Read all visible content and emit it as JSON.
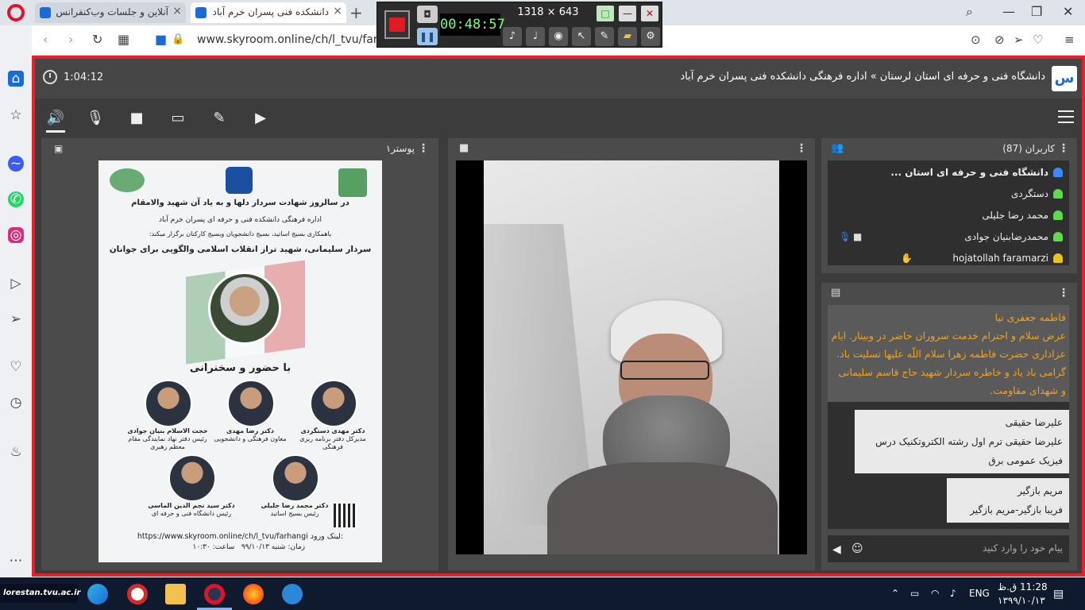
{
  "browser": {
    "tabs": [
      {
        "title": "آنلاین و جلسات وب‌کنفرانس"
      },
      {
        "title": "دانشکده فنی پسران خرم آباد"
      }
    ],
    "new_tab": "+",
    "url": "www.skyroom.online/ch/l_tvu/farhan"
  },
  "recorder": {
    "timer": "00:48:57",
    "dimensions": "1318 × 643",
    "colors": {
      "record": "#e01b24"
    }
  },
  "room": {
    "title": "دانشگاه فنی و حرفه ای استان لرستان » اداره فرهنگی دانشکده فنی پسران خرم آباد",
    "elapsed": "1:04:12",
    "accent_border": "#e8202a"
  },
  "toolbar": {
    "icons": [
      "speaker-icon",
      "mic-muted-icon",
      "camera-icon",
      "screen-share-icon",
      "brush-icon",
      "media-play-icon"
    ]
  },
  "poster_panel": {
    "title": "پوستر۱",
    "poster": {
      "headline1": "در سالروز شهادت سردار دلها و به یاد آن شهید والامقام",
      "headline2": "اداره فرهنگی دانشکده فنی و حرفه ای پسران خرم آباد",
      "headline3": "باهمکاری بسیج اساتید، بسیج دانشجویان وبسیج کارکنان برگزار میکند:",
      "theme": "سردار سلیمانی، شهید تراز انقلاب اسلامی والگویی برای جوانان",
      "with_speech": "با حضور و سخنرانی",
      "speakers": [
        {
          "name": "دکتر مهدی دستگردی",
          "role": "مدیرکل دفتر برنامه ریزی فرهنگی"
        },
        {
          "name": "دکتر رضا مهدی",
          "role": "معاون فرهنگی و دانشجویی"
        },
        {
          "name": "حجت الاسلام بنیان جوادی",
          "role": "رئیس دفتر نهاد نمایندگی مقام معظم رهبری"
        },
        {
          "name": "دکتر محمد رضا جلیلی",
          "role": "رئیس بسیج اساتید"
        },
        {
          "name": "دکتر سید نجم الدین الماسی",
          "role": "رئیس دانشگاه فنی و حرفه ای"
        }
      ],
      "link": "https://www.skyroom.online/ch/l_tvu/farhangi",
      "link_label": "لینک ورود:",
      "date": "زمان: شنبه ۹۹/۱۰/۱۳",
      "time": "ساعت: ۱۰:۳۰"
    }
  },
  "users_panel": {
    "title": "کاربران (87)",
    "users": [
      {
        "name": "دانشگاه فنی و حرفه ای استان ..."
      },
      {
        "name": "دستگردی"
      },
      {
        "name": "محمد رضا جلیلی"
      },
      {
        "name": "محمدرضابنیان جوادی"
      },
      {
        "name": "hojatollah faramarzi"
      }
    ]
  },
  "chat_panel": {
    "messages": [
      {
        "sender": "فاطمه جعفری نیا",
        "text": "عرض سلام و احترام خدمت سروران حاضر در وبینار. ایام عزاداری حضرت فاطمه زهرا سلام اللّه علیها تسلیت باد. گرامی باد یاد و خاطره سردار شهید حاج قاسم سلیمانی و شهدای مقاومت."
      },
      {
        "sender": "علیرضا حقیقی",
        "text": "علیرضا حقیقی ترم اول رشته الکتروتکنیک درس فیزیک عمومی برق"
      },
      {
        "sender": "مریم بازگیر",
        "text": "فریبا بازگیر-مریم بازگیر"
      }
    ],
    "input_placeholder": "پیام خود را وارد کنید"
  },
  "taskbar": {
    "badge": "lorestan.tvu.ac.ir",
    "lang": "ENG",
    "time": "11:28 ق.ظ",
    "date": "۱۳۹۹/۱۰/۱۳"
  }
}
